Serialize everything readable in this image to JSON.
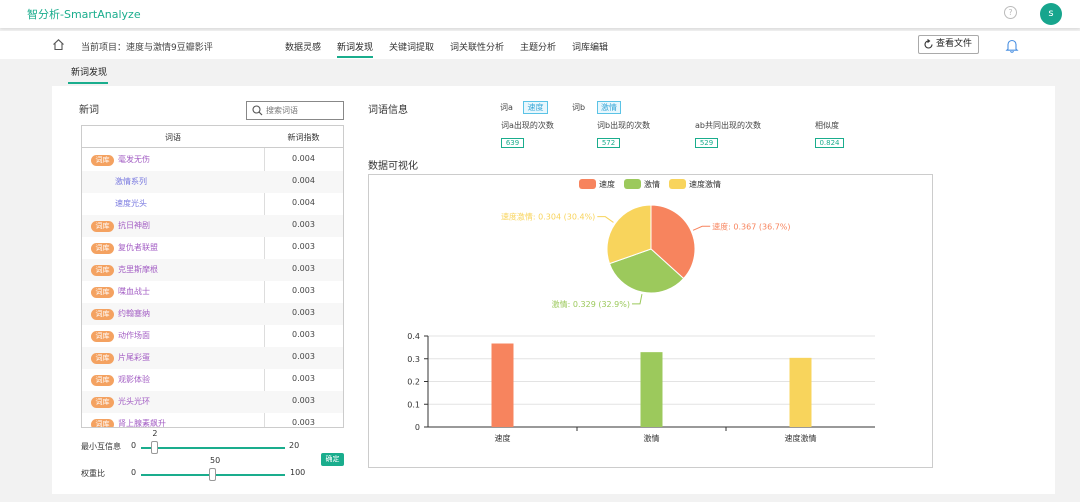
{
  "app": {
    "title": "智分析-SmartAnalyze",
    "avatar_letter": "s",
    "help_icon": "help-circle-icon"
  },
  "nav": {
    "project_label": "当前项目：速度与激情9豆瓣影评",
    "items": [
      "数据灵感",
      "新词发现",
      "关键词提取",
      "词关联性分析",
      "主题分析",
      "词库编辑"
    ],
    "active": "新词发现",
    "view_file_label": "查看文件"
  },
  "subtab": "新词发现",
  "new_words": {
    "title": "新词",
    "search_placeholder": "搜索词语",
    "columns": [
      "词语",
      "新词指数"
    ],
    "tag_label": "词库",
    "rows": [
      {
        "word": "毫发无伤",
        "value": "0.004",
        "tag": true
      },
      {
        "word": "激情系列",
        "value": "0.004",
        "tag": false
      },
      {
        "word": "速度光头",
        "value": "0.004",
        "tag": false
      },
      {
        "word": "抗日神剧",
        "value": "0.003",
        "tag": true
      },
      {
        "word": "复仇者联盟",
        "value": "0.003",
        "tag": true
      },
      {
        "word": "克里斯摩根",
        "value": "0.003",
        "tag": true
      },
      {
        "word": "喋血战士",
        "value": "0.003",
        "tag": true
      },
      {
        "word": "约翰塞纳",
        "value": "0.003",
        "tag": true
      },
      {
        "word": "动作场面",
        "value": "0.003",
        "tag": true
      },
      {
        "word": "片尾彩蛋",
        "value": "0.003",
        "tag": true
      },
      {
        "word": "观影体验",
        "value": "0.003",
        "tag": true
      },
      {
        "word": "光头光环",
        "value": "0.003",
        "tag": true
      },
      {
        "word": "肾上腺素飙升",
        "value": "0.003",
        "tag": true
      }
    ]
  },
  "sliders": {
    "min_mi": {
      "label": "最小互信息",
      "min": "0",
      "max": "20",
      "value": "2",
      "fraction": 0.1
    },
    "weight": {
      "label": "权重比",
      "min": "0",
      "max": "100",
      "value": "50",
      "fraction": 0.5
    },
    "confirm_label": "确定"
  },
  "word_info": {
    "title": "词语信息",
    "word_a_label": "词a",
    "word_a": "速度",
    "word_b_label": "词b",
    "word_b": "激情",
    "stats": [
      {
        "label": "词a出现的次数",
        "value": "639"
      },
      {
        "label": "词b出现的次数",
        "value": "572"
      },
      {
        "label": "ab共同出现的次数",
        "value": "529"
      },
      {
        "label": "相似度",
        "value": "0.824"
      }
    ]
  },
  "viz_title": "数据可视化",
  "colors": {
    "accent": "#1aad8d",
    "speed": "#f7845e",
    "passion": "#9cc95c",
    "both": "#f8d45c"
  },
  "chart_data": [
    {
      "type": "pie",
      "legend": [
        "速度",
        "激情",
        "速度激情"
      ],
      "legend_position": "top-center",
      "slices": [
        {
          "name": "速度",
          "value": 0.367,
          "percent": 36.7,
          "label": "速度: 0.367 (36.7%)"
        },
        {
          "name": "激情",
          "value": 0.329,
          "percent": 32.9,
          "label": "激情: 0.329 (32.9%)"
        },
        {
          "name": "速度激情",
          "value": 0.304,
          "percent": 30.4,
          "label": "速度激情: 0.304 (30.4%)"
        }
      ]
    },
    {
      "type": "bar",
      "categories": [
        "速度",
        "激情",
        "速度激情"
      ],
      "values": [
        0.367,
        0.329,
        0.304
      ],
      "ylim": [
        0,
        0.4
      ],
      "yticks": [
        "0",
        "0.1",
        "0.2",
        "0.3",
        "0.4"
      ],
      "grid": true
    }
  ]
}
